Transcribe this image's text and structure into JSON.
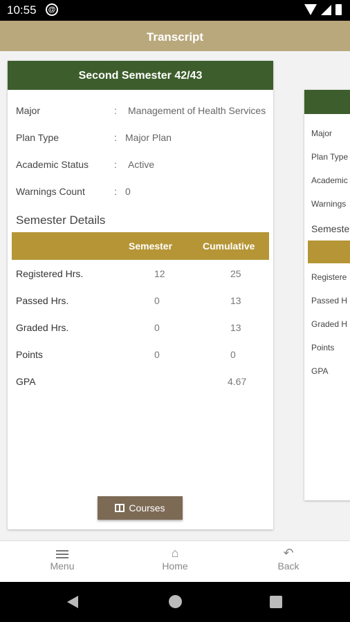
{
  "status_bar": {
    "time": "10:55"
  },
  "app_bar": {
    "title": "Transcript"
  },
  "card": {
    "title": "Second Semester 42/43",
    "info": [
      {
        "label": "Major",
        "value": "Management of Health Services"
      },
      {
        "label": "Plan Type",
        "value": "Major Plan"
      },
      {
        "label": "Academic Status",
        "value": "Active"
      },
      {
        "label": "Warnings Count",
        "value": "0"
      }
    ],
    "section_title": "Semester Details",
    "table": {
      "headers": {
        "semester": "Semester",
        "cumulative": "Cumulative"
      },
      "rows": [
        {
          "label": "Registered Hrs.",
          "semester": "12",
          "cumulative": "25"
        },
        {
          "label": "Passed Hrs.",
          "semester": "0",
          "cumulative": "13"
        },
        {
          "label": "Graded Hrs.",
          "semester": "0",
          "cumulative": "13"
        },
        {
          "label": "Points",
          "semester": "0",
          "cumulative": "0"
        },
        {
          "label": "GPA",
          "semester": "",
          "cumulative": "4.67"
        }
      ]
    },
    "courses_button": "Courses"
  },
  "card2": {
    "labels": [
      "Major",
      "Plan Type",
      "Academic",
      "Warnings"
    ],
    "section_title": "Semeste",
    "row_labels": [
      "Registere",
      "Passed H",
      "Graded H",
      "Points",
      "GPA"
    ]
  },
  "bottom_nav": {
    "menu": "Menu",
    "home": "Home",
    "back": "Back"
  },
  "colors": {
    "app_bar": "#b9a87c",
    "card_header": "#3d5e2c",
    "table_header": "#b59536",
    "courses_button": "#7c6a55"
  }
}
